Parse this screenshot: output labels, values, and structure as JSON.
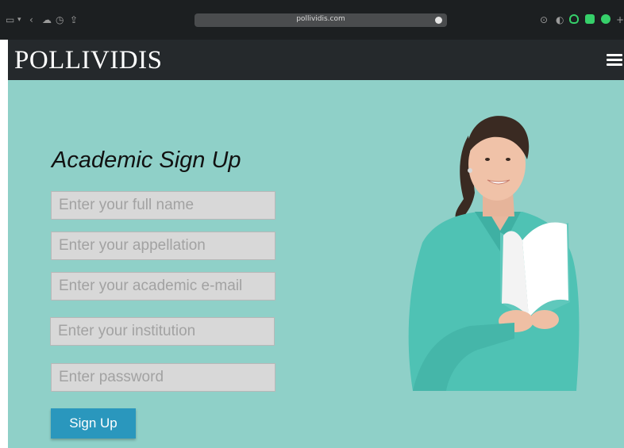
{
  "browser": {
    "url": "pollividis.com",
    "icons": [
      "sidebar-icon",
      "chevron-down-icon",
      "back-icon",
      "cloud-icon",
      "clock-icon",
      "share-icon",
      "download-icon",
      "privacy-icon",
      "shield-icon",
      "camera-icon",
      "extension-icon",
      "plus-icon"
    ]
  },
  "header": {
    "logo": "POLLIVIDIS"
  },
  "form": {
    "title": "Academic Sign Up",
    "fields": [
      {
        "placeholder": "Enter your full name"
      },
      {
        "placeholder": "Enter your appellation"
      },
      {
        "placeholder": "Enter your academic e-mail"
      },
      {
        "placeholder": "Enter your institution"
      },
      {
        "placeholder": "Enter password"
      }
    ],
    "submit_label": "Sign Up"
  },
  "colors": {
    "chrome": "#1c1f21",
    "header": "#25292c",
    "background": "#8fd0c8",
    "field": "#d8d8d8",
    "button": "#2a97bd",
    "shirt": "#4fc2b4"
  }
}
